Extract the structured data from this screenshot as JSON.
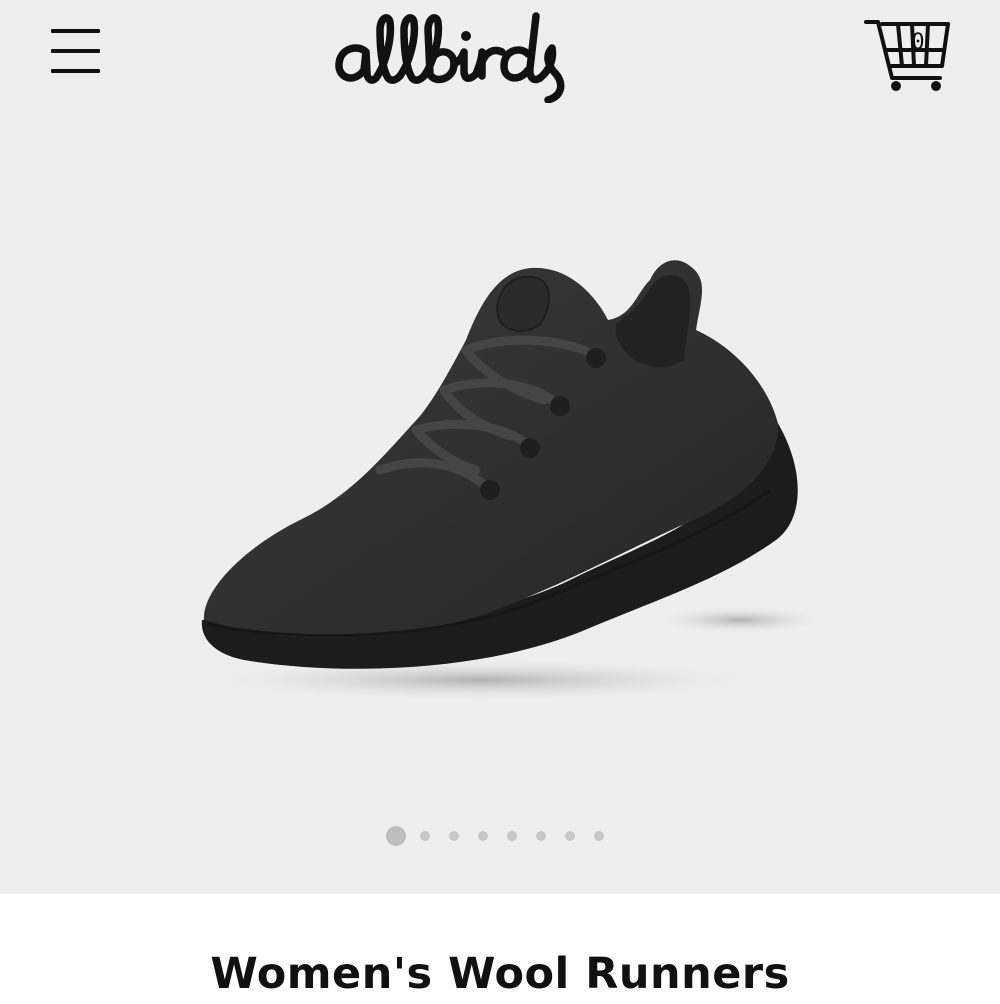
{
  "header": {
    "menu_icon": "hamburger-menu-icon",
    "logo_text": "allbirds",
    "cart_icon": "shopping-cart-icon",
    "cart_count": "0"
  },
  "carousel": {
    "image_subject": "dark grey wool runner sneaker",
    "slide_count": 8,
    "active_slide": 1
  },
  "product": {
    "title": "Women's Wool Runners"
  },
  "colors": {
    "hero_background": "#efeeee",
    "page_background": "#ffffff",
    "text": "#111111"
  }
}
